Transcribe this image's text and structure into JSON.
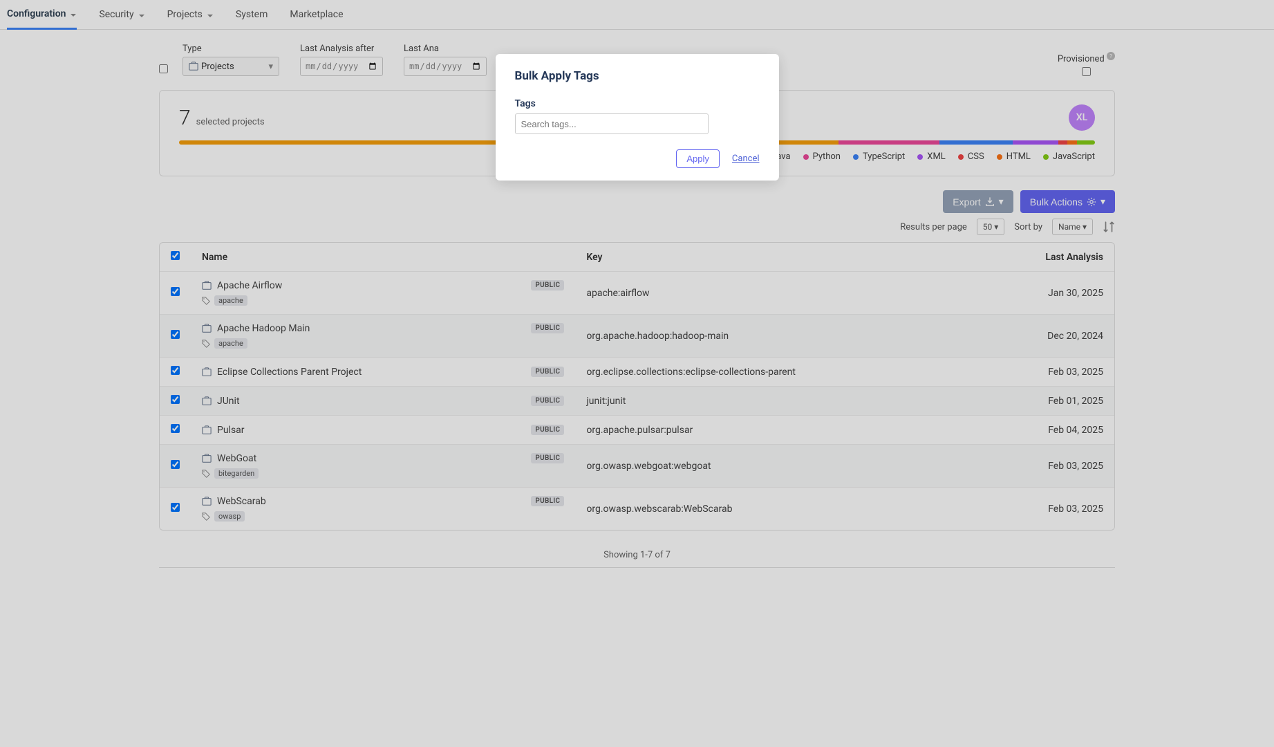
{
  "nav": {
    "items": [
      {
        "label": "Configuration",
        "active": true,
        "dropdown": true
      },
      {
        "label": "Security",
        "active": false,
        "dropdown": true
      },
      {
        "label": "Projects",
        "active": false,
        "dropdown": true
      },
      {
        "label": "System",
        "active": false,
        "dropdown": false
      },
      {
        "label": "Marketplace",
        "active": false,
        "dropdown": false
      }
    ]
  },
  "filters": {
    "type_label": "Type",
    "type_value": "Projects",
    "after_label": "Last Analysis after",
    "after_placeholder": "mm/dd/yyyy",
    "before_label": "Last Ana",
    "before_placeholder": "mm/dd/",
    "provisioned_label": "Provisioned"
  },
  "summary": {
    "count": "7",
    "count_label": "selected projects",
    "avatar": "XL",
    "languages": [
      {
        "name": "Java",
        "color": "#f59e0b",
        "pct": 72
      },
      {
        "name": "Python",
        "color": "#ec4899",
        "pct": 11
      },
      {
        "name": "TypeScript",
        "color": "#3b82f6",
        "pct": 8
      },
      {
        "name": "XML",
        "color": "#a855f7",
        "pct": 5
      },
      {
        "name": "CSS",
        "color": "#ef4444",
        "pct": 1
      },
      {
        "name": "HTML",
        "color": "#f97316",
        "pct": 1
      },
      {
        "name": "JavaScript",
        "color": "#84cc16",
        "pct": 2
      }
    ]
  },
  "toolbar": {
    "export_label": "Export",
    "bulk_label": "Bulk Actions"
  },
  "pager": {
    "results_label": "Results per page",
    "results_value": "50",
    "sort_label": "Sort by",
    "sort_value": "Name"
  },
  "table": {
    "headers": {
      "name": "Name",
      "key": "Key",
      "last": "Last Analysis"
    },
    "rows": [
      {
        "name": "Apache Airflow",
        "badge": "PUBLIC",
        "tags": [
          "apache"
        ],
        "key": "apache:airflow",
        "last": "Jan 30, 2025",
        "checked": true
      },
      {
        "name": "Apache Hadoop Main",
        "badge": "PUBLIC",
        "tags": [
          "apache"
        ],
        "key": "org.apache.hadoop:hadoop-main",
        "last": "Dec 20, 2024",
        "checked": true
      },
      {
        "name": "Eclipse Collections Parent Project",
        "badge": "PUBLIC",
        "tags": [],
        "key": "org.eclipse.collections:eclipse-collections-parent",
        "last": "Feb 03, 2025",
        "checked": true
      },
      {
        "name": "JUnit",
        "badge": "PUBLIC",
        "tags": [],
        "key": "junit:junit",
        "last": "Feb 01, 2025",
        "checked": true
      },
      {
        "name": "Pulsar",
        "badge": "PUBLIC",
        "tags": [],
        "key": "org.apache.pulsar:pulsar",
        "last": "Feb 04, 2025",
        "checked": true
      },
      {
        "name": "WebGoat",
        "badge": "PUBLIC",
        "tags": [
          "bitegarden"
        ],
        "key": "org.owasp.webgoat:webgoat",
        "last": "Feb 03, 2025",
        "checked": true
      },
      {
        "name": "WebScarab",
        "badge": "PUBLIC",
        "tags": [
          "owasp"
        ],
        "key": "org.owasp.webscarab:WebScarab",
        "last": "Feb 03, 2025",
        "checked": true
      }
    ]
  },
  "footer": "Showing 1-7 of 7",
  "modal": {
    "title": "Bulk Apply Tags",
    "tags_label": "Tags",
    "search_placeholder": "Search tags...",
    "apply": "Apply",
    "cancel": "Cancel"
  }
}
